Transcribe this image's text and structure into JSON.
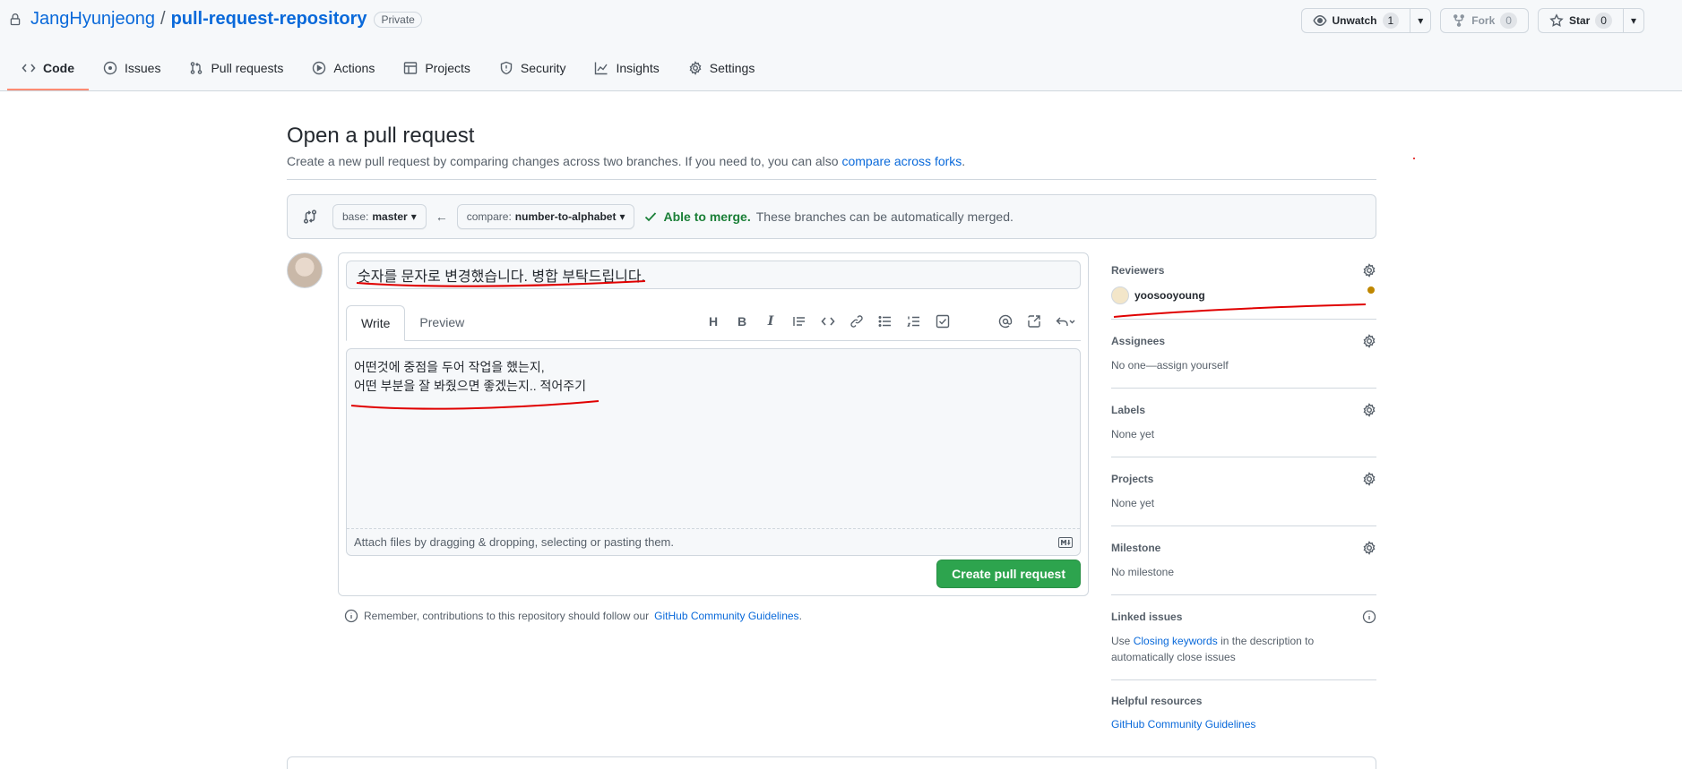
{
  "repo": {
    "owner": "JangHyunjeong",
    "separator": "/",
    "name": "pull-request-repository",
    "visibility": "Private"
  },
  "actions": {
    "unwatch_label": "Unwatch",
    "unwatch_count": "1",
    "fork_label": "Fork",
    "fork_count": "0",
    "star_label": "Star",
    "star_count": "0"
  },
  "nav": [
    {
      "label": "Code",
      "icon": "code-icon",
      "active": true
    },
    {
      "label": "Issues",
      "icon": "issue-icon"
    },
    {
      "label": "Pull requests",
      "icon": "pull-request-icon"
    },
    {
      "label": "Actions",
      "icon": "play-icon"
    },
    {
      "label": "Projects",
      "icon": "table-icon"
    },
    {
      "label": "Security",
      "icon": "shield-icon"
    },
    {
      "label": "Insights",
      "icon": "graph-icon"
    },
    {
      "label": "Settings",
      "icon": "gear-icon"
    }
  ],
  "page": {
    "title": "Open a pull request",
    "subtitle": "Create a new pull request by comparing changes across two branches. If you need to, you can also",
    "subtitle_link": "compare across forks",
    "subtitle_end": "."
  },
  "range": {
    "base_label": "base:",
    "base_value": "master",
    "compare_label": "compare:",
    "compare_value": "number-to-alphabet",
    "merge_ok": "Able to merge.",
    "merge_text": "These branches can be automatically merged."
  },
  "composer": {
    "title_value": "숫자를 문자로 변경했습니다. 병합 부탁드립니다.",
    "tab_write": "Write",
    "tab_preview": "Preview",
    "toolbar_heading": "H",
    "toolbar_bold": "B",
    "toolbar_italic": "I",
    "body_value": "어떤것에 중점을 두어 작업을 했는지,\n어떤 부분을 잘 봐줬으면 좋겠는지.. 적어주기",
    "attach_text": "Attach files by dragging & dropping, selecting or pasting them.",
    "create_button": "Create pull request"
  },
  "remember": {
    "text": "Remember, contributions to this repository should follow our",
    "link": "GitHub Community Guidelines",
    "end": "."
  },
  "sidebar": {
    "reviewers": {
      "title": "Reviewers",
      "user": "yoosooyoung"
    },
    "assignees": {
      "title": "Assignees",
      "value": "No one—assign yourself"
    },
    "labels": {
      "title": "Labels",
      "value": "None yet"
    },
    "projects": {
      "title": "Projects",
      "value": "None yet"
    },
    "milestone": {
      "title": "Milestone",
      "value": "No milestone"
    },
    "linked": {
      "title": "Linked issues",
      "pre": "Use",
      "link": "Closing keywords",
      "post": "in the description to automatically close issues"
    },
    "helpful": {
      "title": "Helpful resources",
      "link": "GitHub Community Guidelines"
    }
  },
  "colors": {
    "accent": "#0969da",
    "success": "#2da44e",
    "annotation": "#e00000"
  }
}
